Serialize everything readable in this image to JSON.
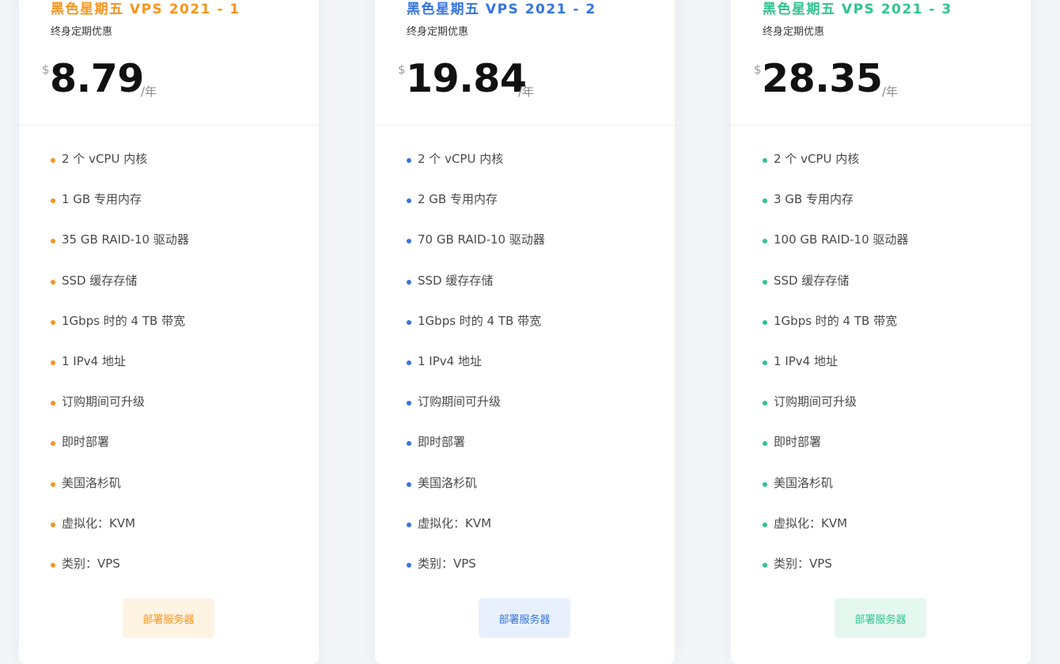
{
  "plans": [
    {
      "title": "黑色星期五 VPS 2021 - 1",
      "subtitle": "终身定期优惠",
      "currency": "$",
      "price": "8.79",
      "period": "/年",
      "accent": "#f7941d",
      "button_bg": "#fff3e4",
      "button_label": "部署服务器",
      "features": [
        "2 个 vCPU 内核",
        "1 GB 专用内存",
        "35 GB RAID-10 驱动器",
        "SSD 缓存存储",
        "1Gbps 时的 4 TB 带宽",
        "1 IPv4 地址",
        "订购期间可升级",
        "即时部署",
        "美国洛杉矶",
        "虚拟化：KVM",
        "类别：VPS"
      ]
    },
    {
      "title": "黑色星期五 VPS 2021 - 2",
      "subtitle": "终身定期优惠",
      "currency": "$",
      "price": "19.84",
      "period": "/年",
      "accent": "#3574e0",
      "button_bg": "#e9f0fd",
      "button_label": "部署服务器",
      "features": [
        "2 个 vCPU 内核",
        "2 GB 专用内存",
        "70 GB RAID-10 驱动器",
        "SSD 缓存存储",
        "1Gbps 时的 4 TB 带宽",
        "1 IPv4 地址",
        "订购期间可升级",
        "即时部署",
        "美国洛杉矶",
        "虚拟化：KVM",
        "类别：VPS"
      ]
    },
    {
      "title": "黑色星期五 VPS 2021 - 3",
      "subtitle": "终身定期优惠",
      "currency": "$",
      "price": "28.35",
      "period": "/年",
      "accent": "#2fc48d",
      "button_bg": "#e5f8ef",
      "button_label": "部署服务器",
      "features": [
        "2 个 vCPU 内核",
        "3 GB 专用内存",
        "100 GB RAID-10 驱动器",
        "SSD 缓存存储",
        "1Gbps 时的 4 TB 带宽",
        "1 IPv4 地址",
        "订购期间可升级",
        "即时部署",
        "美国洛杉矶",
        "虚拟化：KVM",
        "类别：VPS"
      ]
    }
  ]
}
